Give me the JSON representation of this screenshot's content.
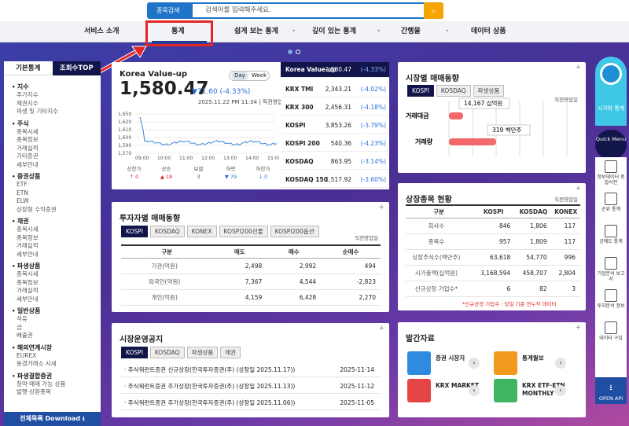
{
  "search": {
    "select": "종목검색",
    "placeholder": "검색어를 입력해주세요."
  },
  "nav": [
    "서비스 소개",
    "통계",
    "쉽게 보는 통계",
    "깊이 있는 통계",
    "간행물",
    "데이터 상품"
  ],
  "left": {
    "tabs": [
      "기본통계",
      "조회수TOP"
    ],
    "groups": [
      {
        "h": "지수",
        "items": [
          "주가지수",
          "채권지수",
          "파생 및 기타지수"
        ]
      },
      {
        "h": "주식",
        "items": [
          "종목시세",
          "종목정보",
          "거래실적",
          "기타증권",
          "세부안내"
        ]
      },
      {
        "h": "증권상품",
        "items": [
          "ETF",
          "ETN",
          "ELW",
          "상장형 수익증권"
        ]
      },
      {
        "h": "채권",
        "items": [
          "종목시세",
          "종목정보",
          "거래실적",
          "세부안내"
        ]
      },
      {
        "h": "파생상품",
        "items": [
          "종목시세",
          "종목정보",
          "거래실적",
          "세부안내"
        ]
      },
      {
        "h": "일반상품",
        "items": [
          "석유",
          "금",
          "배출권"
        ]
      },
      {
        "h": "해외연계시장",
        "items": [
          "EUREX",
          "동경거래소 시세"
        ]
      },
      {
        "h": "파생결합증권",
        "items": [
          "청약·매매 가능 상품",
          "발행·상환종목"
        ]
      }
    ],
    "download": "전체목록 Download"
  },
  "kv": {
    "name": "Korea Value-up",
    "value": "1,580.47",
    "change": "▼71.60 (-4.33%)",
    "time": "2025.11.22 PM 11:34 | 직전영업일",
    "day": "Day",
    "week": "Week",
    "yticks": [
      "1,650",
      "1,620",
      "1,610",
      "1,600",
      "1,590",
      "1,570"
    ],
    "xticks": [
      "09:00",
      "10:00",
      "11:00",
      "12:00",
      "13:00",
      "14:00",
      "15:00"
    ],
    "stats": [
      {
        "l": "상한가",
        "v": "↑ 0",
        "c": "up"
      },
      {
        "l": "상승",
        "v": "▲ 18",
        "c": "up"
      },
      {
        "l": "보합",
        "v": "3",
        "c": ""
      },
      {
        "l": "하락",
        "v": "▼ 79",
        "c": "dn"
      },
      {
        "l": "하한가",
        "v": "↓ 0",
        "c": "dn"
      }
    ]
  },
  "indices": [
    {
      "n": "Korea Value-up",
      "v": "1,580.47",
      "p": "(-4.33%)"
    },
    {
      "n": "KRX TMI",
      "v": "2,343.21",
      "p": "(-4.02%)"
    },
    {
      "n": "KRX 300",
      "v": "2,456.31",
      "p": "(-4.18%)"
    },
    {
      "n": "KOSPI",
      "v": "3,853.26",
      "p": "(-3.79%)"
    },
    {
      "n": "KOSPI 200",
      "v": "540.36",
      "p": "(-4.23%)"
    },
    {
      "n": "KOSDAQ",
      "v": "863.95",
      "p": "(-3.14%)"
    },
    {
      "n": "KOSDAQ 150",
      "v": "1,517.92",
      "p": "(-3.60%)"
    }
  ],
  "investor": {
    "title": "투자자별 매매동향",
    "tabs": [
      "KOSPI",
      "KOSDAQ",
      "KONEX",
      "KOSPI200선물",
      "KOSPI200옵션"
    ],
    "tag": "직전영업일",
    "head": [
      "구분",
      "매도",
      "매수",
      "순매수"
    ],
    "rows": [
      [
        "기관(억원)",
        "2,498",
        "2,992",
        "494"
      ],
      [
        "외국인(억원)",
        "7,367",
        "4,544",
        "-2,823"
      ],
      [
        "개인(억원)",
        "4,159",
        "6,428",
        "2,270"
      ]
    ]
  },
  "notice": {
    "title": "시장운영공지",
    "tabs": [
      "KOSPI",
      "KOSDAQ",
      "파생상품",
      "채권"
    ],
    "rows": [
      [
        "· 주식워런트증권 신규상장(한국투자증권(주) (상장일 2025.11.17))",
        "2025-11-14"
      ],
      [
        "· 주식워런트증권 추가상장(한국투자증권(주) (상장일 2025.11.13))",
        "2025-11-12"
      ],
      [
        "· 주식워런트증권 추가상장(한국투자증권(주) (상장일 2025.11.06))",
        "2025-11-05"
      ]
    ]
  },
  "market": {
    "title": "시장별 매매동향",
    "tabs": [
      "KOSPI",
      "KOSDAQ",
      "파생상품"
    ],
    "tag": "직전영업일",
    "rows": [
      "거래대금",
      "거래량"
    ],
    "tips": [
      "14,167 십억원",
      "319 백만주"
    ]
  },
  "listed": {
    "title": "상장종목 현황",
    "tag": "직전영업일",
    "head": [
      "구분",
      "KOSPI",
      "KOSDAQ",
      "KONEX"
    ],
    "rows": [
      [
        "회사수",
        "846",
        "1,806",
        "117"
      ],
      [
        "종목수",
        "957",
        "1,809",
        "117"
      ],
      [
        "상장주식수(백만주)",
        "63,618",
        "54,770",
        "996"
      ],
      [
        "시가총액(십억원)",
        "3,168,594",
        "458,707",
        "2,804"
      ],
      [
        "신규상장 기업수*",
        "6",
        "82",
        "3"
      ]
    ],
    "note": "*신규상장 기업수 : 당일 기준 연누적 데이터"
  },
  "pub": {
    "title": "발간자료",
    "items": [
      "증권 시장지",
      "통계월보",
      "KRX MARKET",
      "KRX ETF·ETN MONTHLY"
    ]
  },
  "side": {
    "top": "시각화 통계",
    "quick": "Quick Menu",
    "items": [
      "정보데이터 종합사전",
      "순위 통계",
      "공매도 통계",
      "기업분석 보고서",
      "투자분석 정보",
      "데이터 구입"
    ],
    "api": "OPEN API"
  }
}
